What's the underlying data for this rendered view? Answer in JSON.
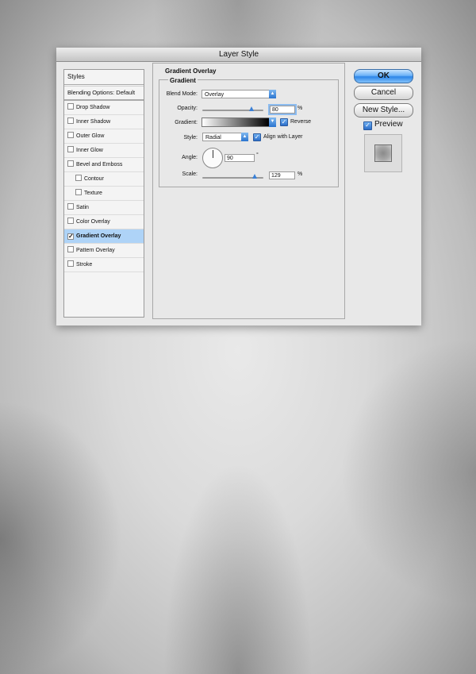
{
  "window": {
    "title": "Layer Style"
  },
  "styles_panel": {
    "header": "Styles",
    "blending_options": "Blending Options: Default",
    "items": [
      {
        "label": "Drop Shadow",
        "checked": false,
        "sub": false,
        "selected": false
      },
      {
        "label": "Inner Shadow",
        "checked": false,
        "sub": false,
        "selected": false
      },
      {
        "label": "Outer Glow",
        "checked": false,
        "sub": false,
        "selected": false
      },
      {
        "label": "Inner Glow",
        "checked": false,
        "sub": false,
        "selected": false
      },
      {
        "label": "Bevel and Emboss",
        "checked": false,
        "sub": false,
        "selected": false
      },
      {
        "label": "Contour",
        "checked": false,
        "sub": true,
        "selected": false
      },
      {
        "label": "Texture",
        "checked": false,
        "sub": true,
        "selected": false
      },
      {
        "label": "Satin",
        "checked": false,
        "sub": false,
        "selected": false
      },
      {
        "label": "Color Overlay",
        "checked": false,
        "sub": false,
        "selected": false
      },
      {
        "label": "Gradient Overlay",
        "checked": true,
        "sub": false,
        "selected": true
      },
      {
        "label": "Pattern Overlay",
        "checked": false,
        "sub": false,
        "selected": false
      },
      {
        "label": "Stroke",
        "checked": false,
        "sub": false,
        "selected": false
      }
    ]
  },
  "gradient_overlay": {
    "section_title": "Gradient Overlay",
    "group_title": "Gradient",
    "blend_mode_label": "Blend Mode:",
    "blend_mode_value": "Overlay",
    "opacity_label": "Opacity:",
    "opacity_value": "80",
    "opacity_slider": 0.8,
    "percent": "%",
    "gradient_label": "Gradient:",
    "reverse_label": "Reverse",
    "style_label": "Style:",
    "style_value": "Radial",
    "align_label": "Align with Layer",
    "angle_label": "Angle:",
    "angle_value": "90",
    "degree": "°",
    "scale_label": "Scale:",
    "scale_value": "129",
    "scale_slider": 0.86
  },
  "buttons": {
    "ok": "OK",
    "cancel": "Cancel",
    "new_style": "New Style...",
    "preview_label": "Preview"
  }
}
